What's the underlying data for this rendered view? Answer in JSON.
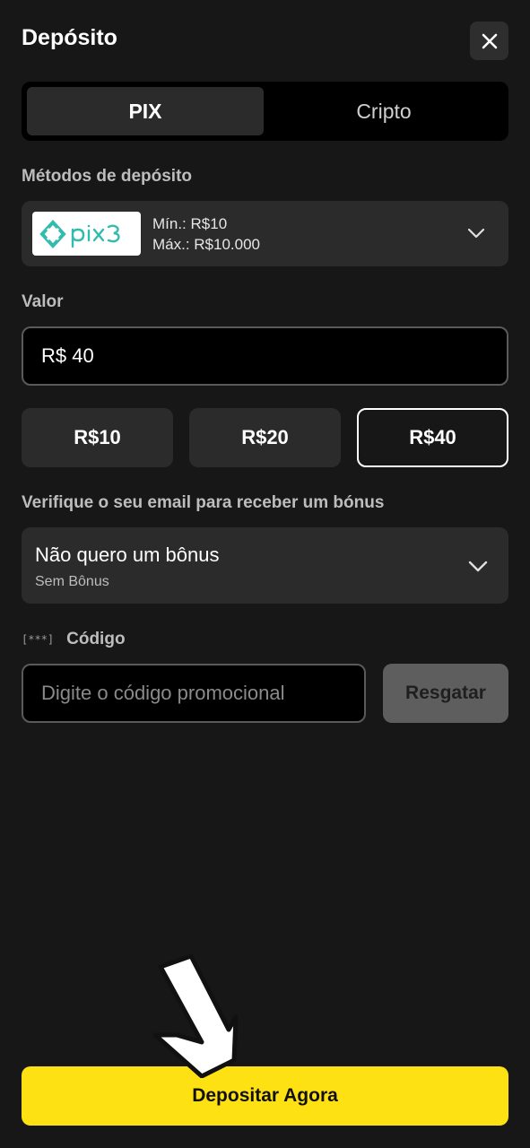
{
  "header": {
    "title": "Depósito",
    "close_icon": "close-icon"
  },
  "tabs": [
    {
      "label": "PIX",
      "active": true
    },
    {
      "label": "Cripto",
      "active": false
    }
  ],
  "deposit_method": {
    "section_label": "Métodos de depósito",
    "logo_text": "pix3",
    "min": "Mín.: R$10",
    "max": "Máx.: R$10.000",
    "chevron_icon": "chevron-down-icon"
  },
  "amount": {
    "section_label": "Valor",
    "value": "R$ 40"
  },
  "quick_amounts": [
    {
      "label": "R$10",
      "selected": false
    },
    {
      "label": "R$20",
      "selected": false
    },
    {
      "label": "R$40",
      "selected": true
    }
  ],
  "bonus": {
    "section_label": "Verifique o seu email para receber um bónus",
    "selected_title": "Não quero um bônus",
    "selected_subtitle": "Sem Bônus",
    "chevron_icon": "chevron-down-icon"
  },
  "promo": {
    "icon_text": "[***]",
    "label": "Código",
    "placeholder": "Digite o código promocional",
    "redeem_label": "Resgatar"
  },
  "footer": {
    "deposit_label": "Depositar Agora"
  },
  "colors": {
    "background": "#171717",
    "card": "#2b2b2b",
    "primary_button": "#fde113",
    "brand_teal": "#32bcad"
  }
}
